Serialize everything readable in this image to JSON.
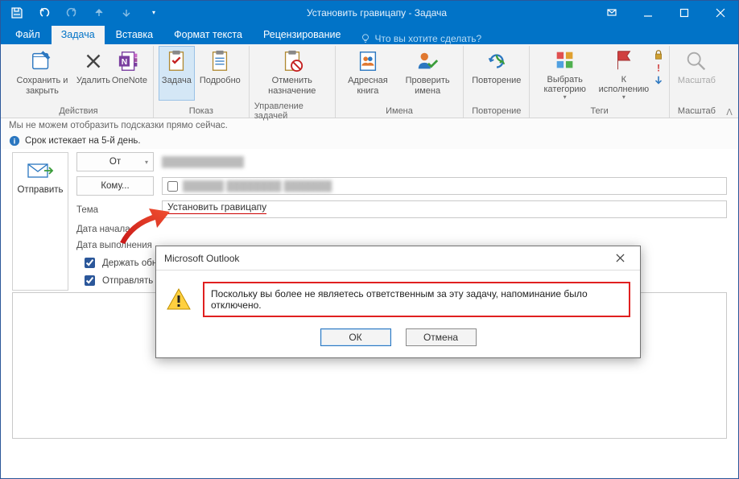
{
  "window": {
    "title": "Установить гравицапу - Задача"
  },
  "tabs": {
    "file": "Файл",
    "task": "Задача",
    "insert": "Вставка",
    "format": "Формат текста",
    "review": "Рецензирование",
    "tellme": "Что вы хотите сделать?"
  },
  "ribbon": {
    "groups": {
      "actions": "Действия",
      "show": "Показ",
      "manage": "Управление задачей",
      "names": "Имена",
      "recurrence": "Повторение",
      "tags": "Теги",
      "zoom": "Масштаб"
    },
    "btns": {
      "save_close": "Сохранить и закрыть",
      "delete": "Удалить",
      "onenote": "OneNote",
      "task": "Задача",
      "details": "Подробно",
      "cancel_assign": "Отменить назначение",
      "address_book": "Адресная книга",
      "check_names": "Проверить имена",
      "recurrence": "Повторение",
      "category": "Выбрать категорию",
      "followup": "К исполнению",
      "zoom": "Масштаб"
    }
  },
  "info": {
    "tips": "Мы не можем отобразить подсказки прямо сейчас.",
    "deadline": "Срок истекает на 5-й день."
  },
  "compose": {
    "send": "Отправить",
    "from_btn": "От",
    "to_btn": "Кому...",
    "subject_label": "Тема",
    "subject_value": "Установить гравицапу",
    "start_label": "Дата начала",
    "due_label": "Дата выполнения",
    "keep_updated": "Держать обн",
    "send_report": "Отправлять м"
  },
  "dialog": {
    "title": "Microsoft Outlook",
    "message": "Поскольку вы более не являетесь ответственным за эту задачу, напоминание было отключено.",
    "ok": "ОК",
    "cancel": "Отмена"
  }
}
